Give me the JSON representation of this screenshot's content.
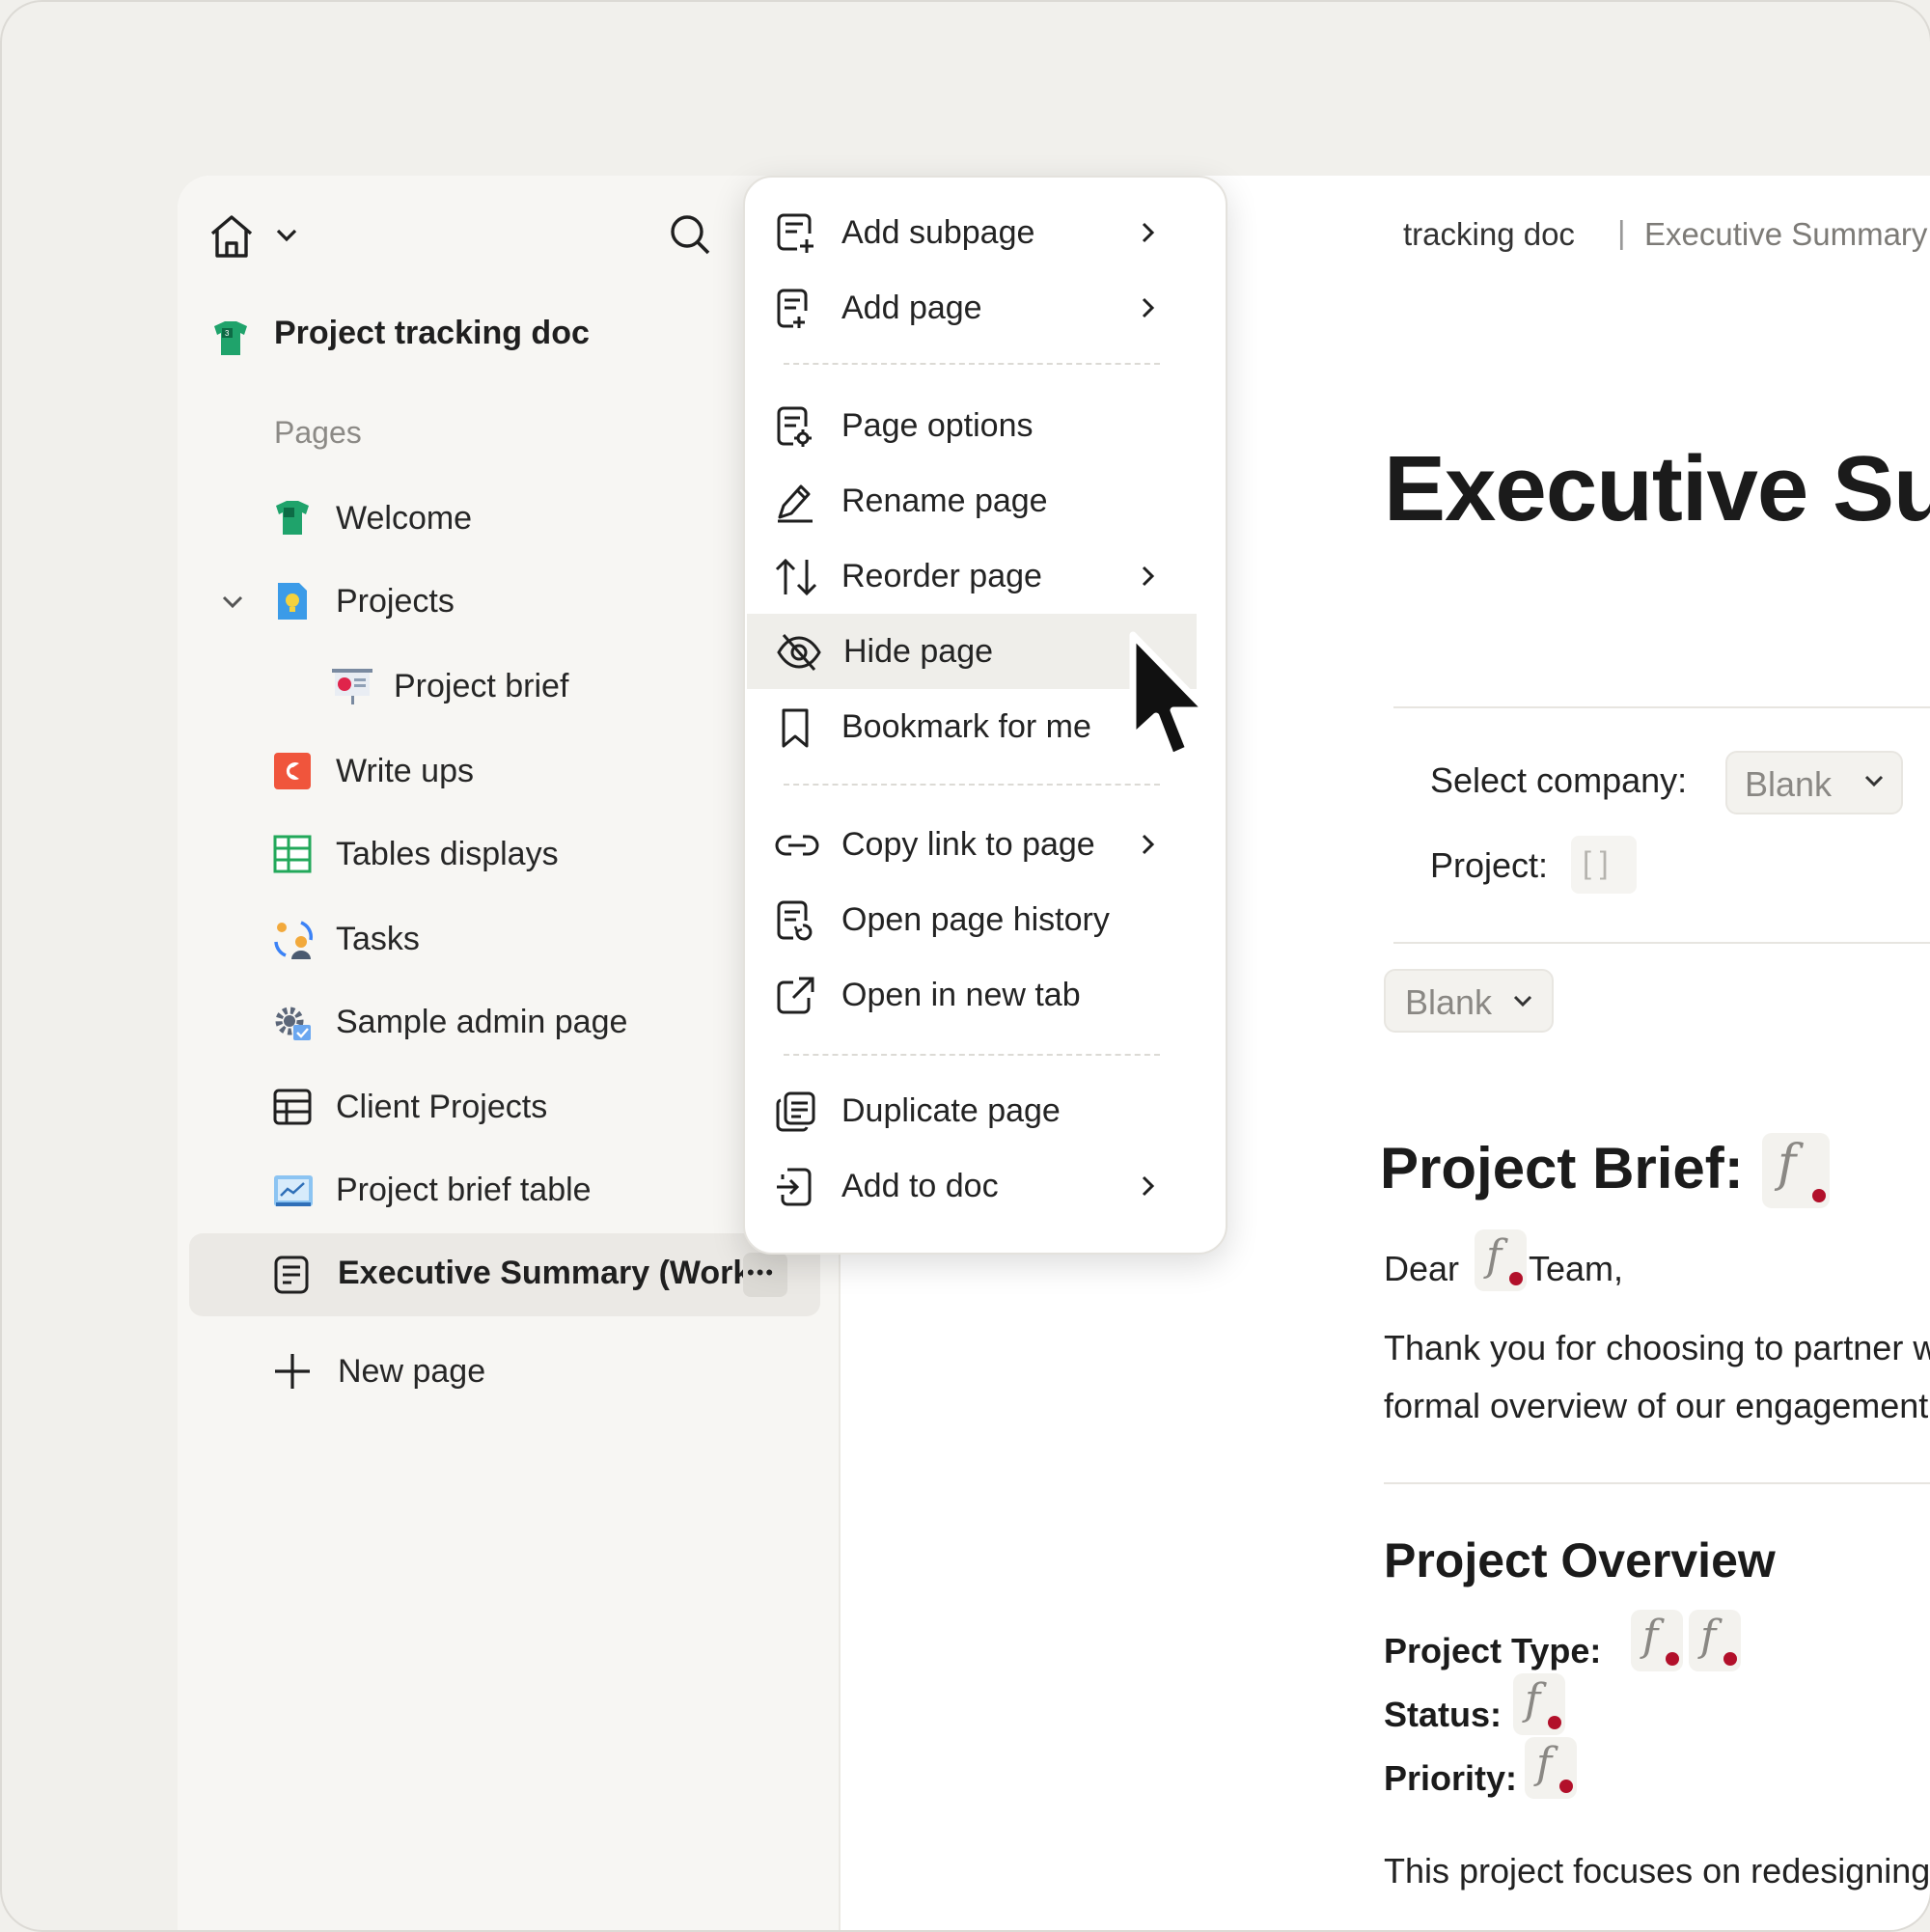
{
  "sidebar": {
    "doc_title": "Project tracking doc",
    "section_label": "Pages",
    "items": [
      {
        "label": "Welcome"
      },
      {
        "label": "Projects"
      },
      {
        "label": "Project brief"
      },
      {
        "label": "Write ups"
      },
      {
        "label": "Tables displays"
      },
      {
        "label": "Tasks"
      },
      {
        "label": "Sample admin page"
      },
      {
        "label": "Client Projects"
      },
      {
        "label": "Project brief table"
      },
      {
        "label": "Executive Summary (Work"
      }
    ],
    "more_label": "•••",
    "new_page_label": "New page"
  },
  "menu": {
    "items": [
      {
        "label": "Add subpage"
      },
      {
        "label": "Add page"
      },
      {
        "label": "Page options"
      },
      {
        "label": "Rename page"
      },
      {
        "label": "Reorder page"
      },
      {
        "label": "Hide page"
      },
      {
        "label": "Bookmark for me"
      },
      {
        "label": "Copy link to page"
      },
      {
        "label": "Open page history"
      },
      {
        "label": "Open in new tab"
      },
      {
        "label": "Duplicate page"
      },
      {
        "label": "Add to doc"
      }
    ]
  },
  "doc": {
    "breadcrumb_doc": "tracking doc",
    "breadcrumb_sep": "|",
    "breadcrumb_page": "Executive Summary (Work in Pr",
    "title": "Executive Summ",
    "select_company_label": "Select company:",
    "select_company_value": "Blank",
    "project_label": "Project:",
    "project_value": "[ ]",
    "blank_select": "Blank",
    "brief_heading": "Project Brief:",
    "formula_glyph": "f",
    "dear_text": "Dear",
    "team_text": "Team,",
    "thanks_line1": "Thank you for choosing to partner with us. W",
    "thanks_line2": "formal overview of our engagement.",
    "overview_heading": "Project Overview",
    "project_type_label": "Project Type:",
    "status_label": "Status:",
    "priority_label": "Priority:",
    "focus_text": "This project focuses on redesigning your st"
  }
}
